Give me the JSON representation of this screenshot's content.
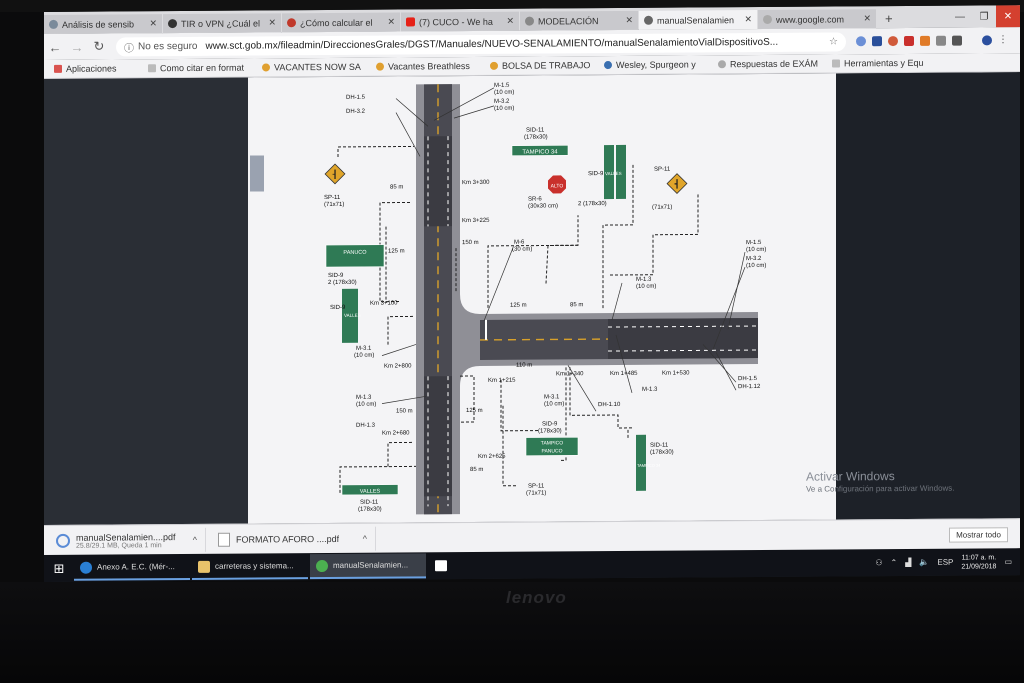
{
  "tabs": [
    {
      "label": "Análisis de sensib",
      "color": "#7a8a9a"
    },
    {
      "label": "TIR o VPN ¿Cuál el",
      "color": "#333333"
    },
    {
      "label": "¿Cómo calcular el",
      "color": "#c0392b"
    },
    {
      "label": "(7) CUCO - We ha",
      "color": "#e62117"
    },
    {
      "label": "MODELACIÓN",
      "color": "#888888"
    },
    {
      "label": "manualSenalamien",
      "color": "#666666"
    },
    {
      "label": "www.google.com",
      "color": "#aaaaaa"
    }
  ],
  "address": {
    "security": "No es seguro",
    "url": "www.sct.gob.mx/fileadmin/DireccionesGrales/DGST/Manuales/NUEVO-SENALAMIENTO/manualSenalamientoVialDispositivoS..."
  },
  "bookmarks": [
    {
      "label": "Aplicaciones",
      "color": "#d9534f"
    },
    {
      "label": "Como citar en format",
      "color": "#999999"
    },
    {
      "label": "VACANTES NOW SA",
      "color": "#e0a030"
    },
    {
      "label": "Vacantes Breathless",
      "color": "#e0a030"
    },
    {
      "label": "BOLSA DE TRABAJO",
      "color": "#e0a030"
    },
    {
      "label": "Wesley, Spurgeon y",
      "color": "#3a6fb0"
    },
    {
      "label": "Respuestas de EXÁM",
      "color": "#aaaaaa"
    },
    {
      "label": "Herramientas y Equ",
      "color": "#999999"
    }
  ],
  "drawing": {
    "labels": {
      "dh15_top": "DH-1.5",
      "dh32_top": "DH-3.2",
      "m15_top": "M-1.5",
      "m15_top_sub": "(10 cm)",
      "m32_top": "M-3.2",
      "m32_top_sub": "(10 cm)",
      "sid11_top": "SID-11",
      "sid11_top_sub": "(178x30)",
      "sign_tampico": "TAMPICO 34",
      "d85a": "85 m",
      "km3300": "Km 3+300",
      "km3225": "Km 3+225",
      "sp11_left": "SP-11",
      "sp11_left_sub": "(71x71)",
      "sr6": "SR-6",
      "sr6_sub": "(30x30 cm)",
      "alto": "ALTO",
      "sid9_right": "SID-9",
      "sid9_right_sub": "2 (178x30)",
      "sign_valles": "VALLES",
      "sp11_right": "SP-11",
      "sp11_right_sub": "(71x71)",
      "d125a": "125 m",
      "sign_panuco": "PANUCO",
      "sid9_left": "SID-9",
      "sid9_left_sub": "2 (178x30)",
      "d150a": "150 m",
      "m6": "M-6",
      "m6_sub": "(30 cm)",
      "d125h": "125 m",
      "d85h": "85 m",
      "m13_right": "M-1.3",
      "m13_right_sub": "(10 cm)",
      "m15_right": "M-1.5",
      "m15_right_sub": "(10 cm)",
      "m32_right": "M-3.2",
      "m32_right_sub": "(10 cm)",
      "km3100": "Km 3+100",
      "sid9_vert": "SID-9",
      "sign_vallesv": "VALLES",
      "m31": "M-3.1",
      "m31_sub": "(10 cm)",
      "km2800": "Km 2+800",
      "d110": "110 m",
      "km1340": "Km 1+340",
      "km1485": "Km 1+485",
      "km1530": "Km 1+530",
      "dh15_right": "DH-1.5",
      "dh112": "DH-1.12",
      "m13_left": "M-1.3",
      "m13_left_sub": "(10 cm)",
      "km1215": "Km 1+215",
      "m31b": "M-3.1",
      "m31b_sub": "(10 cm)",
      "dh110": "DH-1.10",
      "m13b": "M-1.3",
      "d150b": "150 m",
      "d125b": "125 m",
      "dh13": "DH-1.3",
      "km2680": "Km 2+680",
      "sid9_bottom": "SID-9",
      "sid9_bottom_sub": "(178x30)",
      "sign_tampico_b": "TAMPICO",
      "sign_panuco_b": "PANUCO",
      "km2625": "Km 2+625",
      "d85b": "85 m",
      "sp11_bottom": "SP-11",
      "sp11_bottom_sub": "(71x71)",
      "sid11_right": "SID-11",
      "sid11_right_sub": "(178x30)",
      "sign_tampico_v": "TAMPICO 34",
      "sid11_bottom_left": "SID-11",
      "sid11_bottom_left_sub": "(178x30)",
      "sign_valles_b": "VALLES"
    }
  },
  "viewer": {
    "watermark_title": "Activar Windows",
    "watermark_sub": "Ve a Configuración para activar Windows.",
    "show_all": "Mostrar todo"
  },
  "downloads": [
    {
      "name": "manualSenalamien....pdf",
      "meta": "25.8/29.1 MB, Queda 1 min"
    },
    {
      "name": "FORMATO AFORO ....pdf",
      "meta": ""
    }
  ],
  "taskbar": {
    "items": [
      {
        "label": "Anexo A. E.C. (Mér-...",
        "color": "#2a7fd4"
      },
      {
        "label": "carreteras y sistema...",
        "color": "#e8c26a"
      },
      {
        "label": "manualSenalamien...",
        "color": "#4caf50"
      }
    ],
    "lang": "ESP",
    "time": "11:07 a. m.",
    "date": "21/09/2018"
  },
  "brand": "lenovo"
}
